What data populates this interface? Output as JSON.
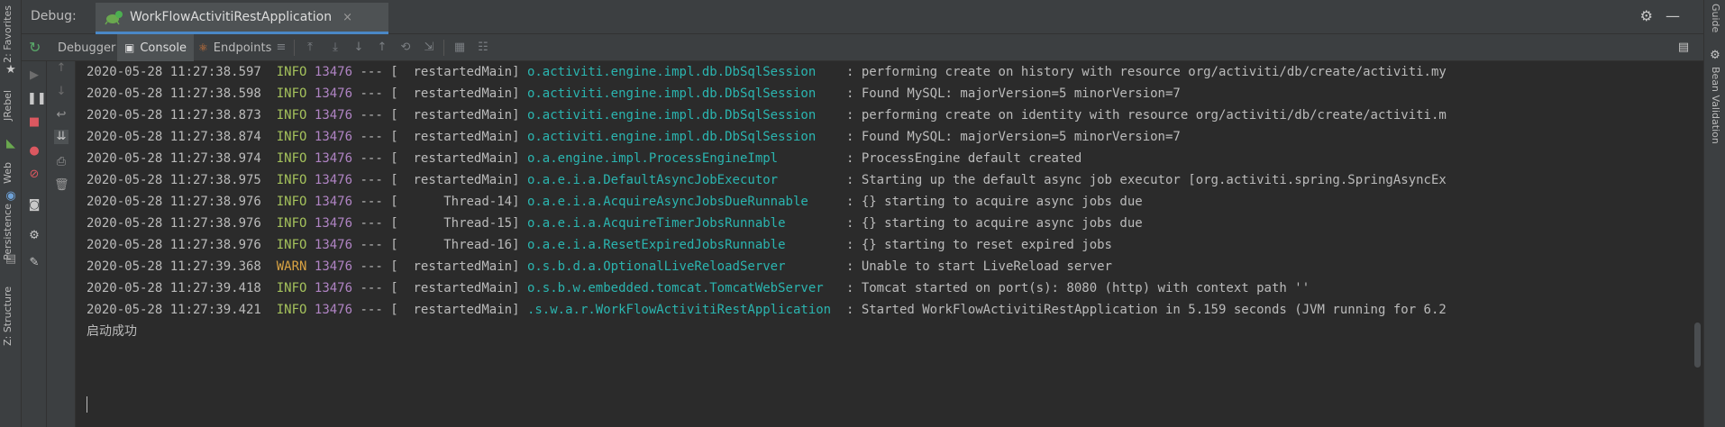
{
  "header": {
    "debug_label": "Debug:",
    "run_tab_title": "WorkFlowActivitiRestApplication",
    "run_tab_close": "×",
    "settings_glyph": "⚙",
    "minimize_glyph": "—"
  },
  "left_strip": {
    "tabs": [
      "2: Favorites",
      "JRebel",
      "Web",
      "Persistence",
      "Z: Structure"
    ]
  },
  "right_strip": {
    "tabs": [
      "Guide",
      "Bean Validation"
    ]
  },
  "toolbar": {
    "tabs": [
      {
        "label": "Debugger"
      },
      {
        "label": "Console"
      },
      {
        "label": "Endpoints"
      }
    ]
  },
  "console": {
    "lines": [
      {
        "ts": "2020-05-28 11:27:38.597",
        "level": "INFO",
        "pid": "13476",
        "sep": "---",
        "thread": "[  restartedMain]",
        "logger": "o.activiti.engine.impl.db.DbSqlSession   ",
        "msg": ": performing create on history with resource org/activiti/db/create/activiti.my"
      },
      {
        "ts": "2020-05-28 11:27:38.598",
        "level": "INFO",
        "pid": "13476",
        "sep": "---",
        "thread": "[  restartedMain]",
        "logger": "o.activiti.engine.impl.db.DbSqlSession   ",
        "msg": ": Found MySQL: majorVersion=5 minorVersion=7"
      },
      {
        "ts": "2020-05-28 11:27:38.873",
        "level": "INFO",
        "pid": "13476",
        "sep": "---",
        "thread": "[  restartedMain]",
        "logger": "o.activiti.engine.impl.db.DbSqlSession   ",
        "msg": ": performing create on identity with resource org/activiti/db/create/activiti.m"
      },
      {
        "ts": "2020-05-28 11:27:38.874",
        "level": "INFO",
        "pid": "13476",
        "sep": "---",
        "thread": "[  restartedMain]",
        "logger": "o.activiti.engine.impl.db.DbSqlSession   ",
        "msg": ": Found MySQL: majorVersion=5 minorVersion=7"
      },
      {
        "ts": "2020-05-28 11:27:38.974",
        "level": "INFO",
        "pid": "13476",
        "sep": "---",
        "thread": "[  restartedMain]",
        "logger": "o.a.engine.impl.ProcessEngineImpl        ",
        "msg": ": ProcessEngine default created"
      },
      {
        "ts": "2020-05-28 11:27:38.975",
        "level": "INFO",
        "pid": "13476",
        "sep": "---",
        "thread": "[  restartedMain]",
        "logger": "o.a.e.i.a.DefaultAsyncJobExecutor        ",
        "msg": ": Starting up the default async job executor [org.activiti.spring.SpringAsyncEx"
      },
      {
        "ts": "2020-05-28 11:27:38.976",
        "level": "INFO",
        "pid": "13476",
        "sep": "---",
        "thread": "[      Thread-14]",
        "logger": "o.a.e.i.a.AcquireAsyncJobsDueRunnable    ",
        "msg": ": {} starting to acquire async jobs due"
      },
      {
        "ts": "2020-05-28 11:27:38.976",
        "level": "INFO",
        "pid": "13476",
        "sep": "---",
        "thread": "[      Thread-15]",
        "logger": "o.a.e.i.a.AcquireTimerJobsRunnable       ",
        "msg": ": {} starting to acquire async jobs due"
      },
      {
        "ts": "2020-05-28 11:27:38.976",
        "level": "INFO",
        "pid": "13476",
        "sep": "---",
        "thread": "[      Thread-16]",
        "logger": "o.a.e.i.a.ResetExpiredJobsRunnable       ",
        "msg": ": {} starting to reset expired jobs"
      },
      {
        "ts": "2020-05-28 11:27:39.368",
        "level": "WARN",
        "pid": "13476",
        "sep": "---",
        "thread": "[  restartedMain]",
        "logger": "o.s.b.d.a.OptionalLiveReloadServer       ",
        "msg": ": Unable to start LiveReload server"
      },
      {
        "ts": "2020-05-28 11:27:39.418",
        "level": "INFO",
        "pid": "13476",
        "sep": "---",
        "thread": "[  restartedMain]",
        "logger": "o.s.b.w.embedded.tomcat.TomcatWebServer  ",
        "msg": ": Tomcat started on port(s): 8080 (http) with context path ''"
      },
      {
        "ts": "2020-05-28 11:27:39.421",
        "level": "INFO",
        "pid": "13476",
        "sep": "---",
        "thread": "[  restartedMain]",
        "logger": ".s.w.a.r.WorkFlowActivitiRestApplication ",
        "msg": ": Started WorkFlowActivitiRestApplication in 5.159 seconds (JVM running for 6.2"
      }
    ],
    "final_text": "启动成功"
  },
  "colors": {
    "info": "#a5c25c",
    "warn": "#d9a343",
    "pid": "#b084c4",
    "logger": "#2bb5b0",
    "accent": "#4a88c7"
  }
}
